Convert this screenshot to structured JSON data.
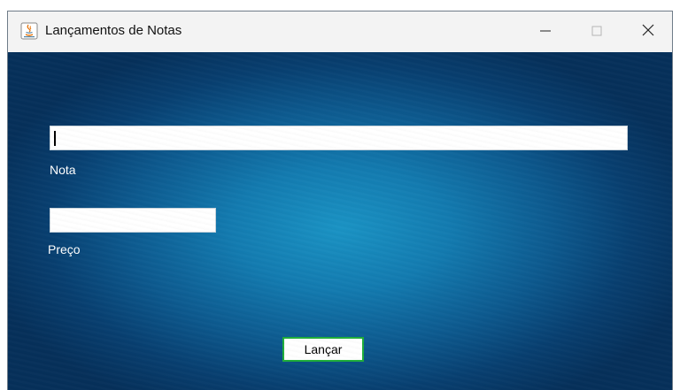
{
  "window": {
    "title": "Lançamentos de Notas",
    "app_icon": "java-icon",
    "controls": {
      "minimize_icon": "minimize-icon",
      "maximize_icon": "maximize-icon",
      "close_icon": "close-icon"
    }
  },
  "form": {
    "nota": {
      "label": "Nota",
      "value": ""
    },
    "preco": {
      "label": "Preço",
      "value": ""
    },
    "submit_label": "Lançar"
  },
  "colors": {
    "background_dark": "#06305a",
    "background_light": "#1a93c4",
    "button_border": "#1fae3a",
    "label_text": "#ffffff"
  }
}
